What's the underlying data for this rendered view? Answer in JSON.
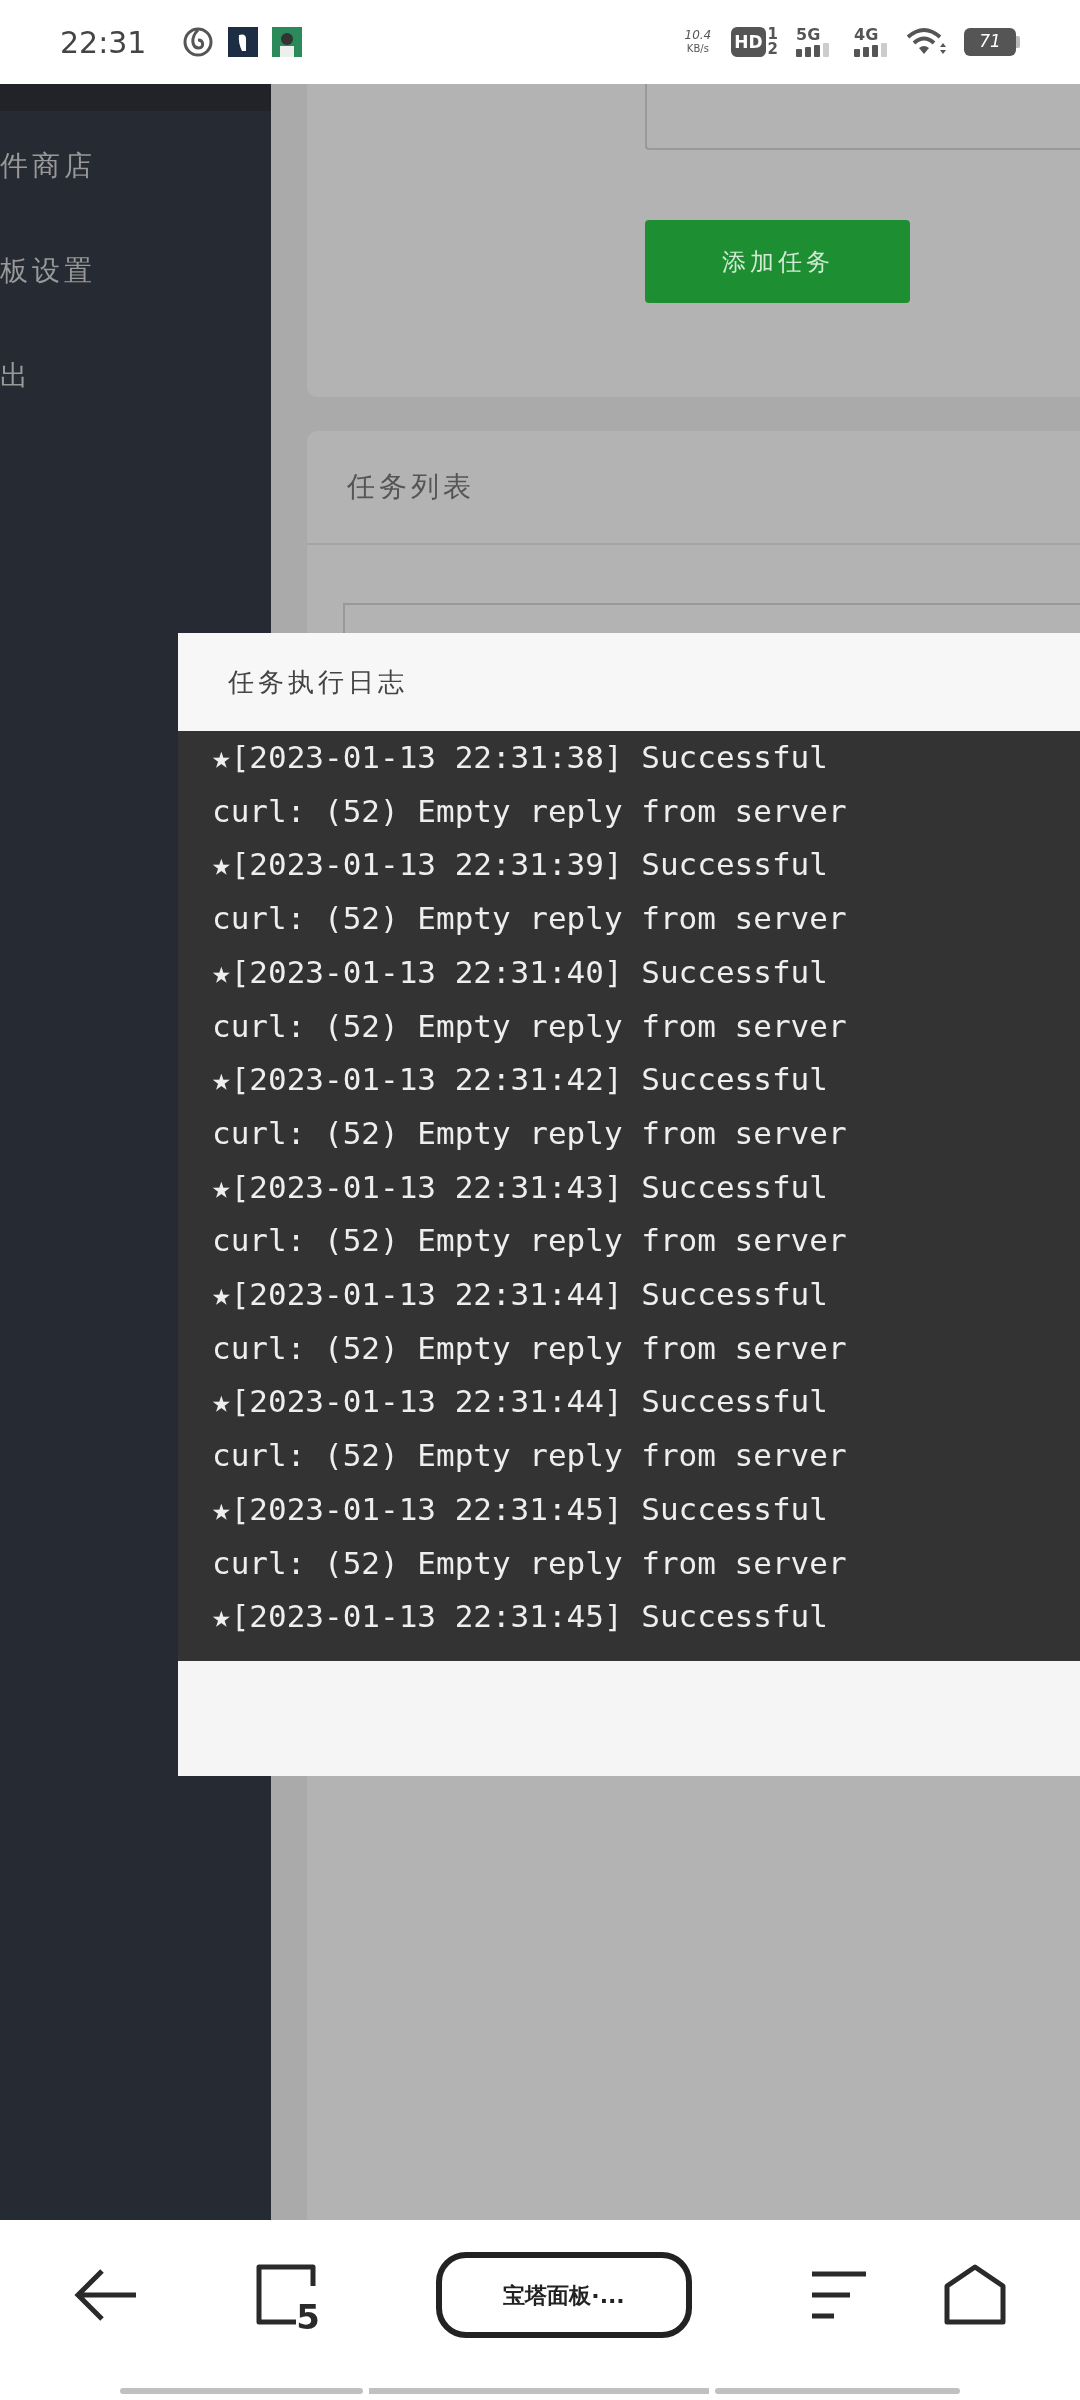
{
  "status_bar": {
    "time": "22:31",
    "network_speed": "10.4",
    "speed_unit": "KB/s",
    "hd_label": "HD",
    "sim_1": "1",
    "sim_2": "2",
    "network_1": "5G",
    "network_2": "4G",
    "battery": "71"
  },
  "sidebar": {
    "items": [
      {
        "label": "件商店"
      },
      {
        "label": "板设置"
      },
      {
        "label": "出"
      }
    ]
  },
  "task_form": {
    "add_button": "添加任务"
  },
  "task_list": {
    "title": "任务列表"
  },
  "log_dialog": {
    "title": "任务执行日志",
    "lines": [
      "★[2023-01-13 22:31:38] Successful",
      "curl: (52) Empty reply from server",
      "★[2023-01-13 22:31:39] Successful",
      "curl: (52) Empty reply from server",
      "★[2023-01-13 22:31:40] Successful",
      "curl: (52) Empty reply from server",
      "★[2023-01-13 22:31:42] Successful",
      "curl: (52) Empty reply from server",
      "★[2023-01-13 22:31:43] Successful",
      "curl: (52) Empty reply from server",
      "★[2023-01-13 22:31:44] Successful",
      "curl: (52) Empty reply from server",
      "★[2023-01-13 22:31:44] Successful",
      "curl: (52) Empty reply from server",
      "★[2023-01-13 22:31:45] Successful",
      "curl: (52) Empty reply from server",
      "★[2023-01-13 22:31:45] Successful"
    ]
  },
  "browser_bar": {
    "tab_count": "5",
    "address": "宝塔面板·..."
  }
}
